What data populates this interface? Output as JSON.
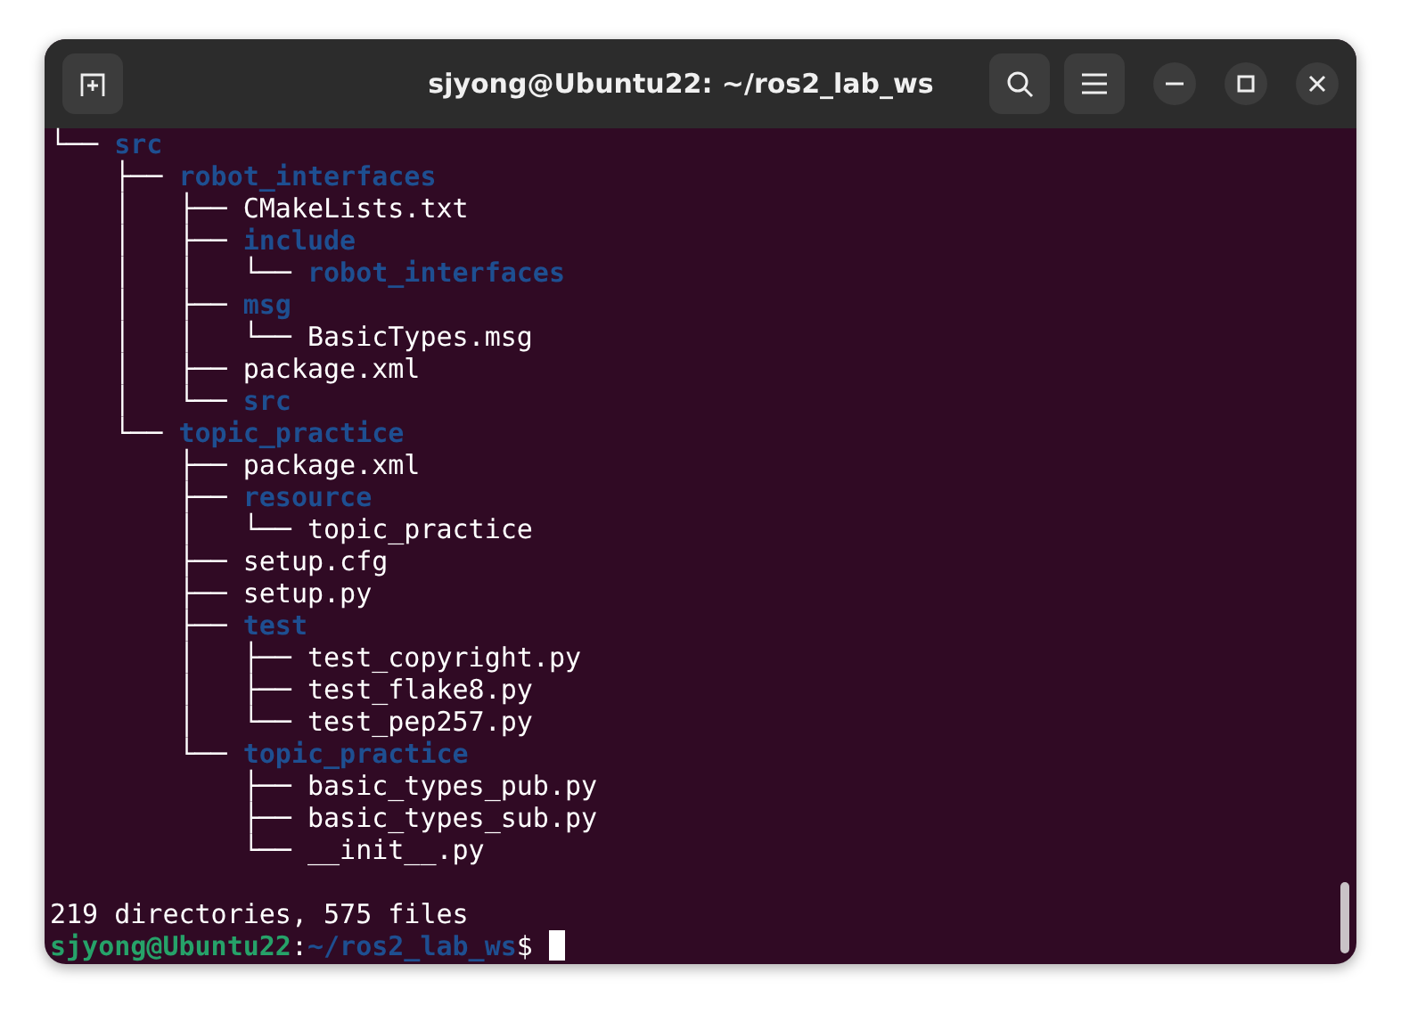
{
  "window": {
    "title": "sjyong@Ubuntu22: ~/ros2_lab_ws"
  },
  "lines": [
    {
      "prefix": "└── ",
      "name": "src",
      "kind": "dir"
    },
    {
      "prefix": "    ├── ",
      "name": "robot_interfaces",
      "kind": "dir"
    },
    {
      "prefix": "    │   ├── ",
      "name": "CMakeLists.txt",
      "kind": "file"
    },
    {
      "prefix": "    │   ├── ",
      "name": "include",
      "kind": "dir"
    },
    {
      "prefix": "    │   │   └── ",
      "name": "robot_interfaces",
      "kind": "dir"
    },
    {
      "prefix": "    │   ├── ",
      "name": "msg",
      "kind": "dir"
    },
    {
      "prefix": "    │   │   └── ",
      "name": "BasicTypes.msg",
      "kind": "file"
    },
    {
      "prefix": "    │   ├── ",
      "name": "package.xml",
      "kind": "file"
    },
    {
      "prefix": "    │   └── ",
      "name": "src",
      "kind": "dir"
    },
    {
      "prefix": "    └── ",
      "name": "topic_practice",
      "kind": "dir"
    },
    {
      "prefix": "        ├── ",
      "name": "package.xml",
      "kind": "file"
    },
    {
      "prefix": "        ├── ",
      "name": "resource",
      "kind": "dir"
    },
    {
      "prefix": "        │   └── ",
      "name": "topic_practice",
      "kind": "file"
    },
    {
      "prefix": "        ├── ",
      "name": "setup.cfg",
      "kind": "file"
    },
    {
      "prefix": "        ├── ",
      "name": "setup.py",
      "kind": "file"
    },
    {
      "prefix": "        ├── ",
      "name": "test",
      "kind": "dir"
    },
    {
      "prefix": "        │   ├── ",
      "name": "test_copyright.py",
      "kind": "file"
    },
    {
      "prefix": "        │   ├── ",
      "name": "test_flake8.py",
      "kind": "file"
    },
    {
      "prefix": "        │   └── ",
      "name": "test_pep257.py",
      "kind": "file"
    },
    {
      "prefix": "        └── ",
      "name": "topic_practice",
      "kind": "dir"
    },
    {
      "prefix": "            ├── ",
      "name": "basic_types_pub.py",
      "kind": "file"
    },
    {
      "prefix": "            ├── ",
      "name": "basic_types_sub.py",
      "kind": "file"
    },
    {
      "prefix": "            └── ",
      "name": "__init__.py",
      "kind": "file"
    }
  ],
  "summary": "219 directories, 575 files",
  "prompt": {
    "user_host": "sjyong@Ubuntu22",
    "separator": ":",
    "path": "~/ros2_lab_ws",
    "symbol": "$"
  }
}
